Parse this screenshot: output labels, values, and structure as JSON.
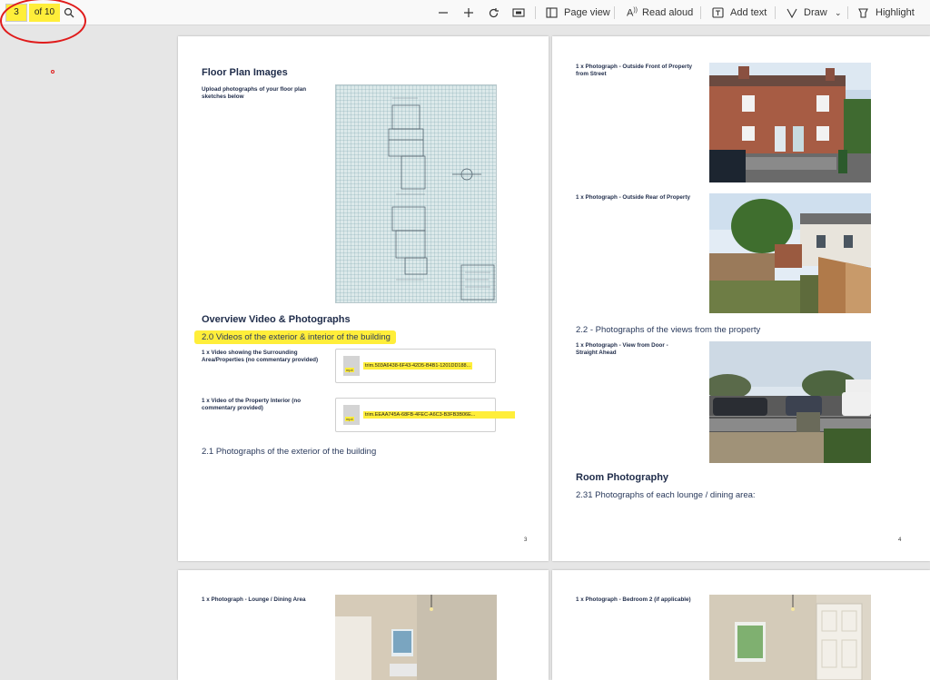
{
  "toolbar": {
    "page_current": "3",
    "page_total": "of 10",
    "page_view": "Page view",
    "read_aloud": "Read aloud",
    "add_text": "Add text",
    "draw": "Draw",
    "highlight": "Highlight"
  },
  "page3": {
    "floor_plan_title": "Floor Plan Images",
    "floor_plan_label": "Upload photographs of your floor plan sketches below",
    "overview_title": "Overview Video & Photographs",
    "section_2_0": "2.0 Videos of the exterior & interior of the building",
    "video1_label": "1 x Video showing the Surrounding Area/Properties (no commentary provided)",
    "video1_file": "trim.503A6438-6F43-42D5-B4B1-1201DD188...",
    "video2_label": "1 x Video of the Property Interior (no commentary provided)",
    "video2_file": "trim.EEAA745A-68FB-4FEC-A6C3-B3FB3B06E...",
    "section_2_1": "2.1 Photographs of the exterior of the building",
    "page_number": "3"
  },
  "page4": {
    "photo_front_label": "1 x Photograph - Outside Front of Property from Street",
    "photo_rear_label": "1 x Photograph - Outside Rear of Property",
    "section_2_2": "2.2 - Photographs of the views from the property",
    "photo_view_label": "1 x Photograph - View from Door - Straight Ahead",
    "room_title": "Room Photography",
    "section_2_31": "2.31 Photographs of each lounge / dining area:",
    "page_number": "4"
  },
  "page5": {
    "lounge_label": "1 x Photograph - Lounge / Dining Area"
  },
  "page6": {
    "bedroom_label": "1 x Photograph - Bedroom 2 (if applicable)"
  },
  "file_badge": "mp4"
}
